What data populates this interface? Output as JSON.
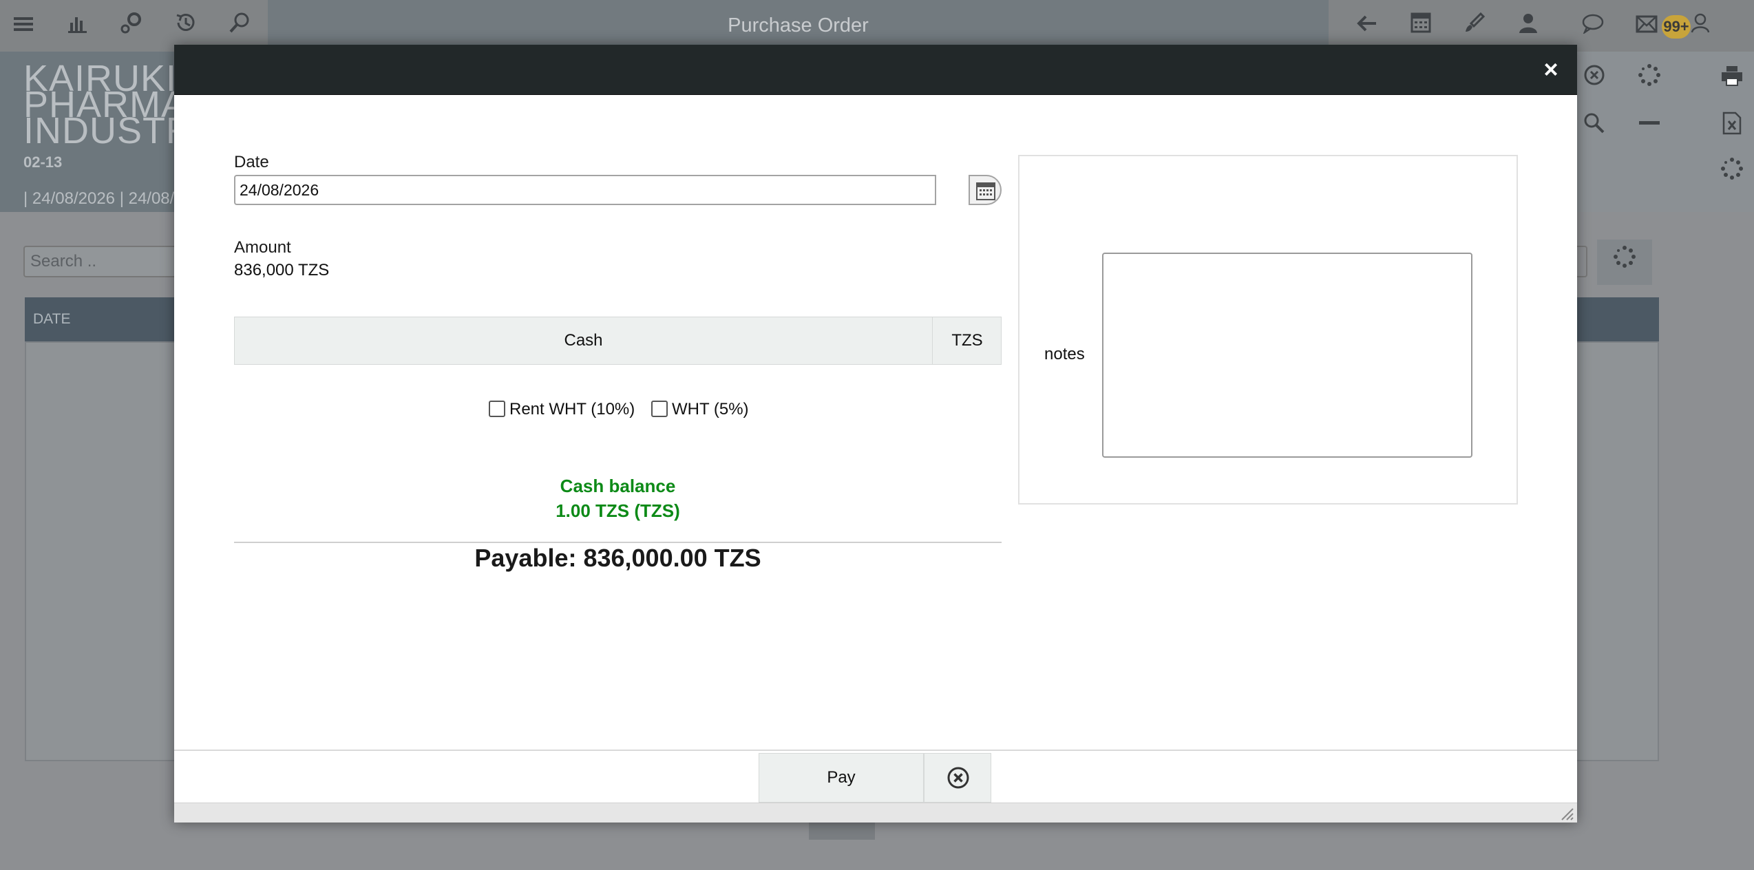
{
  "app": {
    "page_title": "Purchase Order",
    "notification_count": "99+",
    "company_name": "KAIRUKI\nPHARMA\nINDUSTR",
    "document_code": "02-13",
    "date_range": "| 24/08/2026 | 24/08/",
    "search_placeholder": "Search ..",
    "table_header_date": "DATE",
    "toolbar_icons": [
      "menu-icon",
      "chart-icon",
      "gears-icon",
      "history-icon",
      "search-icon",
      "back-arrow-icon",
      "calculator-icon",
      "brush-icon",
      "user-icon",
      "chat-icon",
      "mail-icon",
      "profile-icon",
      "print-icon",
      "excel-icon",
      "spinner-icon",
      "minus-icon",
      "cancel-circle-icon"
    ]
  },
  "modal": {
    "title": "",
    "close_label": "×",
    "date_label": "Date",
    "date_value": "24/08/2026",
    "amount_label": "Amount",
    "amount_value": "836,000 TZS",
    "payment_method": "Cash",
    "currency": "TZS",
    "checkbox_rent_wht": "Rent WHT (10%)",
    "checkbox_wht": "WHT (5%)",
    "balance_label": "Cash balance",
    "balance_value": "1.00 TZS (TZS)",
    "payable_text": "Payable: 836,000.00 TZS",
    "notes_label": "notes",
    "notes_value": "",
    "pay_button": "Pay",
    "colors": {
      "balance_green": "#0d8a17",
      "titlebar": "#222829"
    }
  }
}
